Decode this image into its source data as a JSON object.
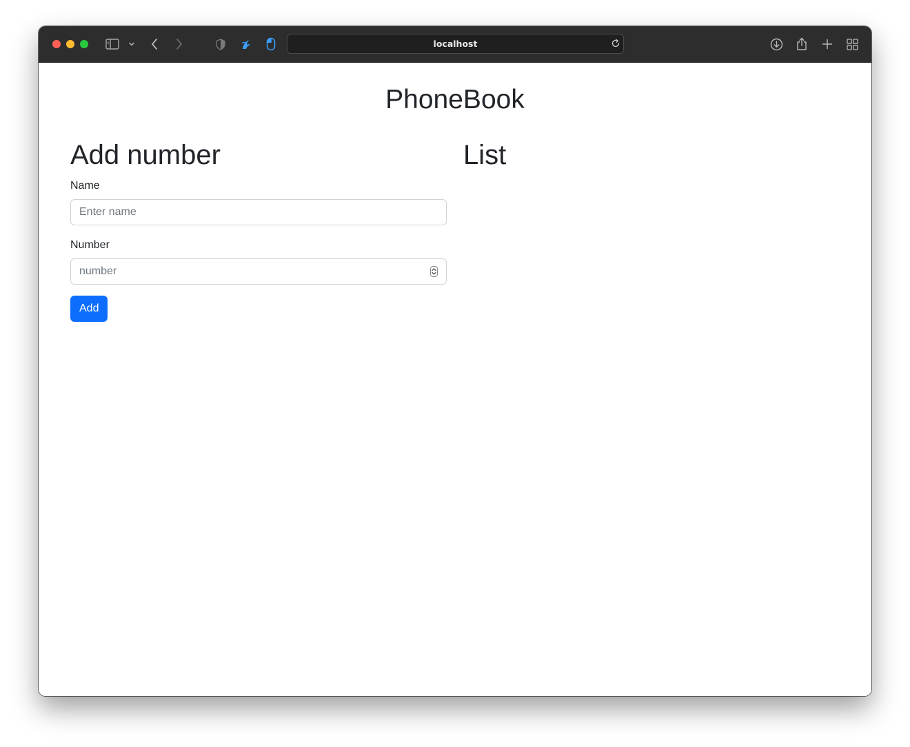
{
  "browser": {
    "url": "localhost"
  },
  "page": {
    "title": "PhoneBook"
  },
  "add_form": {
    "heading": "Add number",
    "name_label": "Name",
    "name_placeholder": "Enter name",
    "name_value": "",
    "number_label": "Number",
    "number_placeholder": "number",
    "number_value": "",
    "submit_label": "Add"
  },
  "list": {
    "heading": "List",
    "items": []
  },
  "colors": {
    "primary_button": "#0d6efd",
    "text": "#212529",
    "titlebar": "#2d2d2d"
  }
}
